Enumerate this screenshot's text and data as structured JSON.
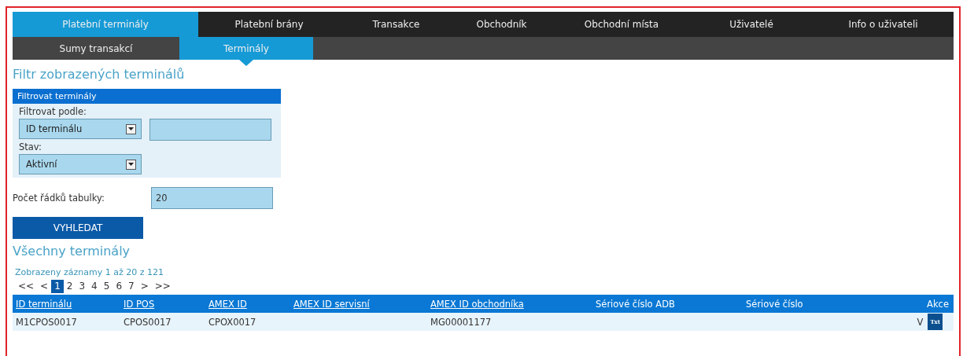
{
  "main_tabs": [
    {
      "label": "Platební terminály",
      "selected": true
    },
    {
      "label": "Platební brány",
      "selected": false
    },
    {
      "label": "Transakce",
      "selected": false
    },
    {
      "label": "Obchodník",
      "selected": false
    },
    {
      "label": "Obchodní místa",
      "selected": false
    },
    {
      "label": "Uživatelé",
      "selected": false
    },
    {
      "label": "Info o uživateli",
      "selected": false
    }
  ],
  "sub_tabs": [
    {
      "label": "Sumy transakcí",
      "selected": false
    },
    {
      "label": "Terminály",
      "selected": true
    }
  ],
  "filter_title": "Filtr zobrazených terminálů",
  "filter_panel": {
    "title": "Filtrovat terminály",
    "filter_by_label": "Filtrovat podle:",
    "filter_by_value": "ID terminálu",
    "status_label": "Stav:",
    "status_value": "Aktivní"
  },
  "rows_label": "Počet řádků tabulky:",
  "rows_value": "20",
  "search_button": "VYHLEDAT",
  "results_title": "Všechny terminály",
  "results_info": "Zobrazeny záznamy 1 až 20 z 121",
  "pagination": [
    {
      "label": "<<",
      "selected": false
    },
    {
      "label": "<",
      "selected": false
    },
    {
      "label": "1",
      "selected": true
    },
    {
      "label": "2",
      "selected": false
    },
    {
      "label": "3",
      "selected": false
    },
    {
      "label": "4",
      "selected": false
    },
    {
      "label": "5",
      "selected": false
    },
    {
      "label": "6",
      "selected": false
    },
    {
      "label": "7",
      "selected": false
    },
    {
      "label": ">",
      "selected": false
    },
    {
      "label": ">>",
      "selected": false
    }
  ],
  "table": {
    "columns": [
      {
        "label": "ID terminálu",
        "sortable": true
      },
      {
        "label": "ID POS",
        "sortable": true
      },
      {
        "label": "AMEX ID",
        "sortable": true
      },
      {
        "label": "AMEX ID servisní",
        "sortable": true
      },
      {
        "label": "AMEX ID obchodníka",
        "sortable": true
      },
      {
        "label": "Sériové číslo ADB",
        "sortable": false
      },
      {
        "label": "Sériové číslo",
        "sortable": false
      },
      {
        "label": "Akce",
        "sortable": false
      }
    ],
    "rows": [
      {
        "cells": [
          "M1CPOS0017",
          "CPOS0017",
          "CPOX0017",
          null,
          "MG00001177",
          null,
          null
        ],
        "action_text": "V",
        "action_button": "Txt"
      }
    ]
  }
}
